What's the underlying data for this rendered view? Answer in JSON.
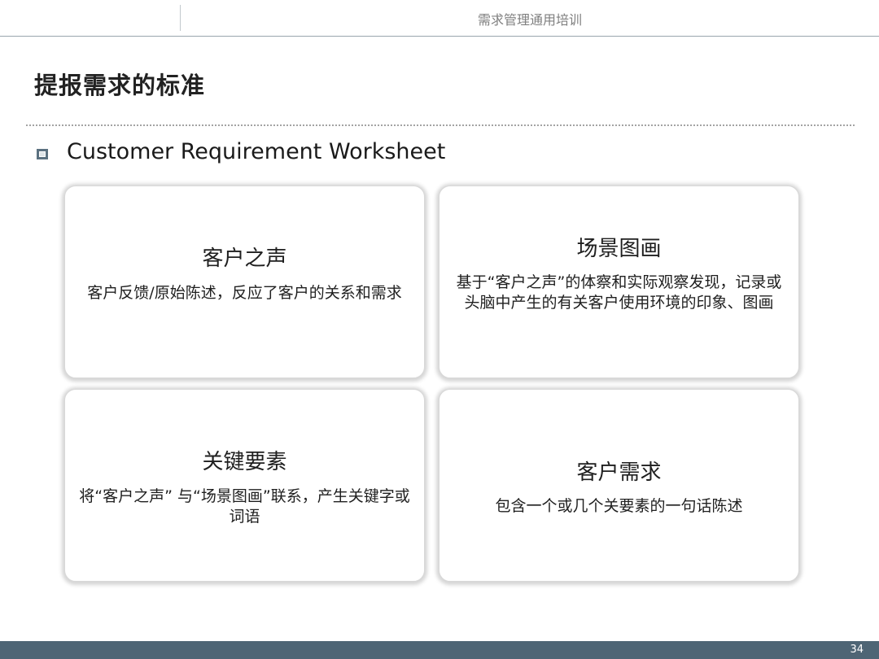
{
  "header": {
    "title": "需求管理通用培训"
  },
  "slide": {
    "title": "提报需求的标准",
    "subtitle": "Customer Requirement Worksheet"
  },
  "cards": [
    {
      "title": "客户之声",
      "body": "客户反馈/原始陈述，反应了客户的关系和需求"
    },
    {
      "title": "场景图画",
      "body": "基于“客户之声”的体察和实际观察发现，记录或头脑中产生的有关客户使用环境的印象、图画"
    },
    {
      "title": "关键要素",
      "body": "将“客户之声” 与“场景图画”联系，产生关键字或词语"
    },
    {
      "title": "客户需求",
      "body": "包含一个或几个关要素的一句话陈述"
    }
  ],
  "footer": {
    "page_number": "34"
  },
  "colors": {
    "footer_bar": "#4e6575",
    "bullet": "#5b7180",
    "header_text": "#7f7f7f"
  },
  "icons": {
    "bullet": "hollow-square-bullet-icon"
  }
}
